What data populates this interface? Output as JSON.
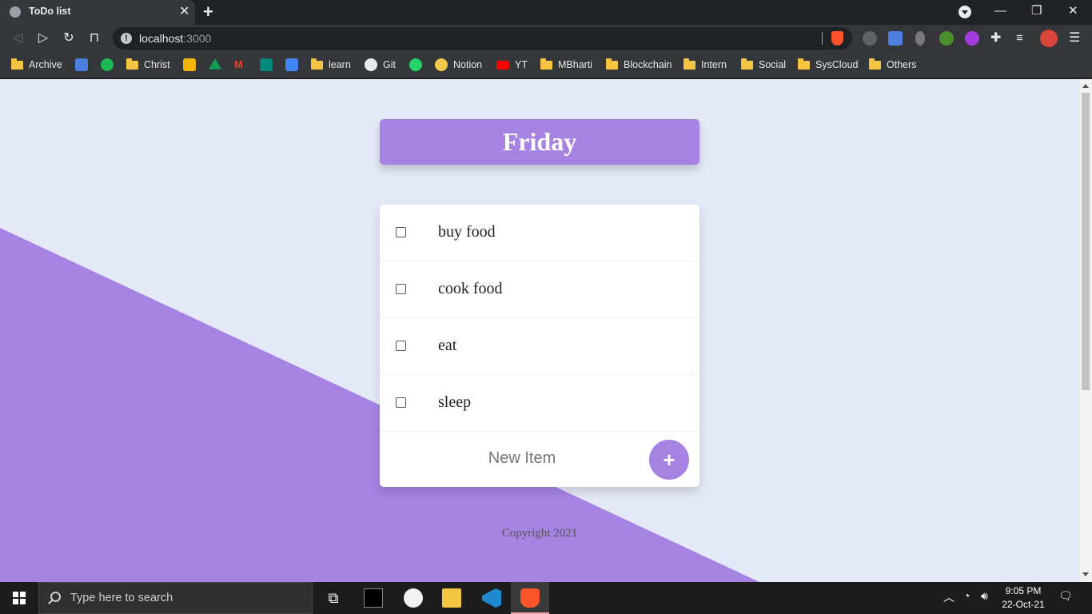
{
  "browser": {
    "tab_title": "ToDo list",
    "url_host": "localhost",
    "url_port": ":3000",
    "bookmarks": [
      {
        "label": "Archive",
        "icon": "folder-icon"
      },
      {
        "label": "",
        "icon": "google-forms-icon"
      },
      {
        "label": "",
        "icon": "spotify-icon"
      },
      {
        "label": "Christ",
        "icon": "folder-icon"
      },
      {
        "label": "",
        "icon": "google-classroom-icon"
      },
      {
        "label": "",
        "icon": "google-drive-icon"
      },
      {
        "label": "",
        "icon": "gmail-icon"
      },
      {
        "label": "",
        "icon": "google-meet-icon"
      },
      {
        "label": "",
        "icon": "google-calendar-icon"
      },
      {
        "label": "learn",
        "icon": "folder-icon"
      },
      {
        "label": "Git",
        "icon": "github-icon"
      },
      {
        "label": "",
        "icon": "whatsapp-icon"
      },
      {
        "label": "Notion",
        "icon": "notion-icon"
      },
      {
        "label": "YT",
        "icon": "youtube-icon"
      },
      {
        "label": "MBharti",
        "icon": "folder-icon"
      },
      {
        "label": "Blockchain",
        "icon": "folder-icon"
      },
      {
        "label": "Intern",
        "icon": "folder-icon"
      },
      {
        "label": "Social",
        "icon": "folder-icon"
      },
      {
        "label": "SysCloud",
        "icon": "folder-icon"
      },
      {
        "label": "Others",
        "icon": "folder-icon"
      }
    ]
  },
  "page": {
    "heading": "Friday",
    "items": [
      "buy food",
      "cook food",
      "eat",
      "sleep"
    ],
    "new_item_placeholder": "New Item",
    "add_button_label": "+",
    "footer": "Copyright 2021"
  },
  "taskbar": {
    "search_placeholder": "Type here to search",
    "time": "9:05 PM",
    "date": "22-Oct-21"
  },
  "colors": {
    "accent": "#a683e3",
    "page_background": "#e4e9f7"
  }
}
